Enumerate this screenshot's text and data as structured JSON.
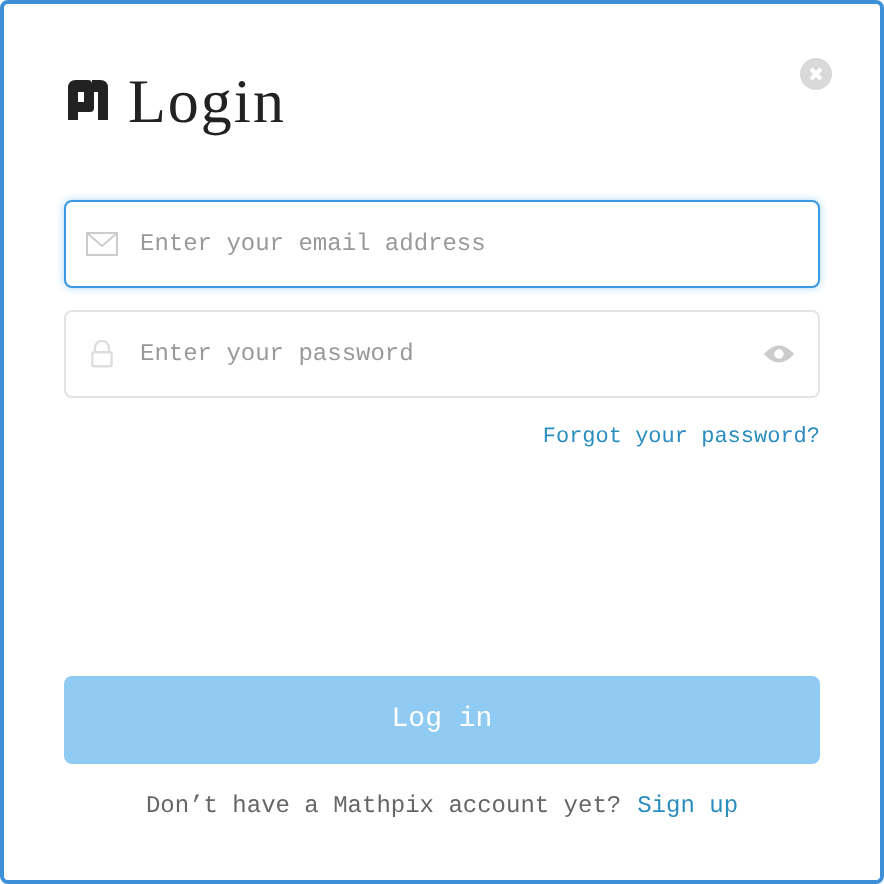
{
  "title": "Login",
  "fields": [
    {
      "kind": "email",
      "placeholder": "Enter your email address",
      "focused": true
    },
    {
      "kind": "password",
      "placeholder": "Enter your password",
      "focused": false
    }
  ],
  "forgot_link": "Forgot your password?",
  "login_button": {
    "label": "Log in",
    "disabled": true
  },
  "footer": {
    "text": "Don’t have a Mathpix account yet?",
    "link": "Sign up"
  }
}
